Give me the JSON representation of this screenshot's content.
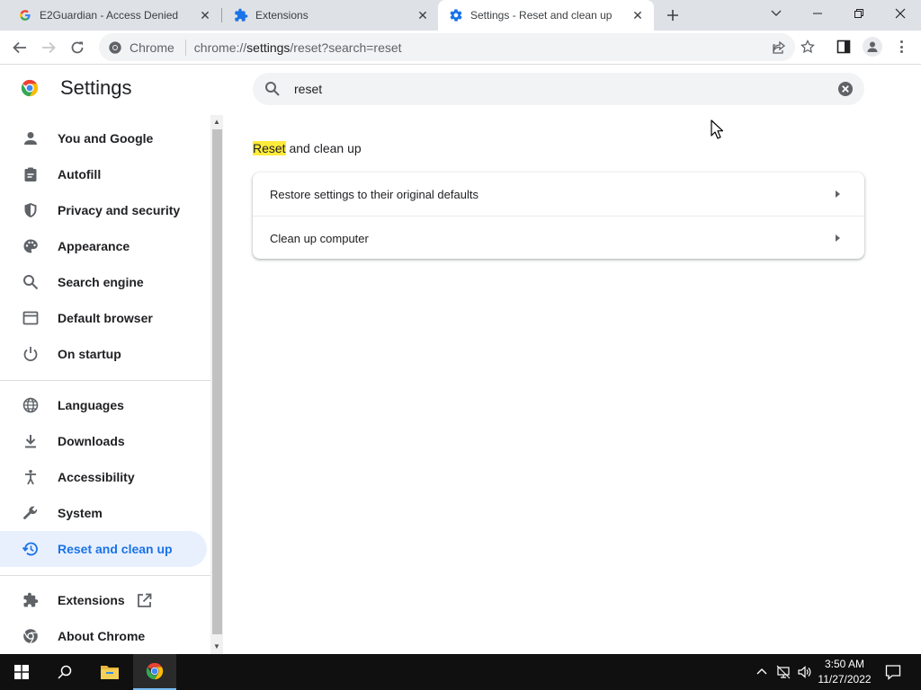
{
  "tabs": [
    {
      "title": "E2Guardian - Access Denied",
      "icon": "google-g-icon"
    },
    {
      "title": "Extensions",
      "icon": "puzzle-icon"
    },
    {
      "title": "Settings - Reset and clean up",
      "icon": "gear-icon"
    }
  ],
  "omnibox": {
    "site_label": "Chrome",
    "url_scheme": "chrome://",
    "url_host": "settings",
    "url_path": "/reset?search=reset"
  },
  "settings": {
    "title": "Settings",
    "search_value": "reset"
  },
  "sidebar": {
    "items": [
      {
        "label": "You and Google",
        "icon": "person-icon"
      },
      {
        "label": "Autofill",
        "icon": "clipboard-icon"
      },
      {
        "label": "Privacy and security",
        "icon": "shield-icon"
      },
      {
        "label": "Appearance",
        "icon": "palette-icon"
      },
      {
        "label": "Search engine",
        "icon": "search-icon"
      },
      {
        "label": "Default browser",
        "icon": "browser-icon"
      },
      {
        "label": "On startup",
        "icon": "power-icon"
      },
      {
        "label": "Languages",
        "icon": "globe-icon"
      },
      {
        "label": "Downloads",
        "icon": "download-icon"
      },
      {
        "label": "Accessibility",
        "icon": "accessibility-icon"
      },
      {
        "label": "System",
        "icon": "wrench-icon"
      },
      {
        "label": "Reset and clean up",
        "icon": "restore-icon",
        "active": true
      },
      {
        "label": "Extensions",
        "icon": "puzzle-icon"
      },
      {
        "label": "About Chrome",
        "icon": "chrome-icon"
      }
    ]
  },
  "main": {
    "section_title_highlight": "Reset",
    "section_title_rest": " and clean up",
    "rows": [
      {
        "label": "Restore settings to their original defaults"
      },
      {
        "label": "Clean up computer"
      }
    ]
  },
  "taskbar": {
    "time": "3:50 AM",
    "date": "11/27/2022"
  },
  "colors": {
    "accent": "#1a73e8",
    "active_nav_bg": "#e8f0fe",
    "highlight": "#ffeb3b",
    "tabstrip": "#dee1e6",
    "taskbar": "#101010"
  }
}
